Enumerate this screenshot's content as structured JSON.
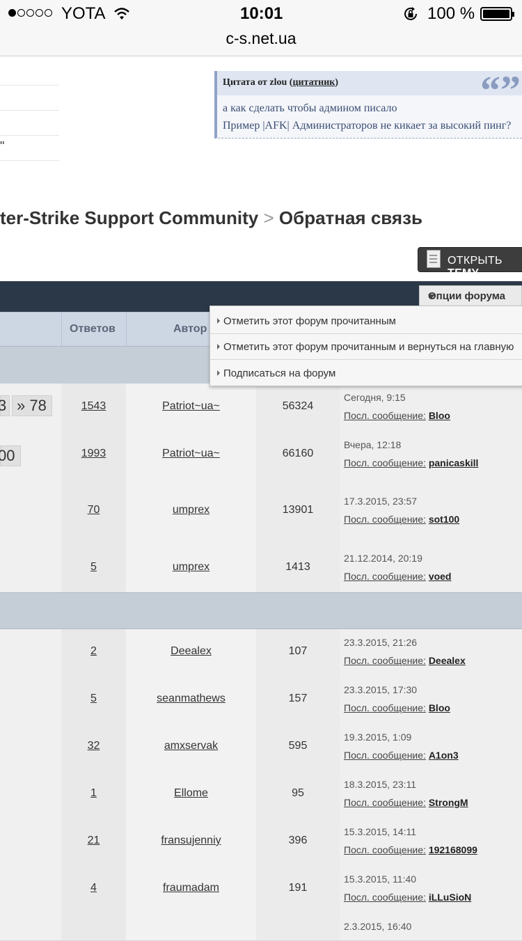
{
  "status": {
    "carrier": "YOTA",
    "time": "10:01",
    "battery": "100 %",
    "url": "c-s.net.ua"
  },
  "quote": {
    "author_prefix": "Цитата от zlou (",
    "link": "цитатник",
    "suffix": ")",
    "lines": [
      "а как сделать чтобы админом писало",
      "Пример |AFK| Администраторов не кикает за высокий пинг?"
    ]
  },
  "left_stub": "\"",
  "breadcrumb": {
    "parent": "ter-Strike Support Community",
    "sep": ">",
    "current": "Обратная связь"
  },
  "open_topic": {
    "label_a": "ОТКРЫТЬ ",
    "label_b": "ТЕМУ"
  },
  "forum_options": "Опции форума",
  "menu": [
    "Отметить этот форум прочитанным",
    "Отметить этот форум прочитанным и вернуться на главную",
    "Подписаться на форум"
  ],
  "columns": {
    "replies": "Ответов",
    "author": "Автор"
  },
  "pagers": {
    "row1_a": "3",
    "row1_b": "» 78",
    "row2": "00"
  },
  "last_prefix": "Посл. сообщение:",
  "rows": [
    {
      "replies": "1543",
      "author": "Patriot~ua~",
      "views": "56324",
      "date": "Сегодня, 9:15",
      "last_user": "Bloo"
    },
    {
      "replies": "1993",
      "author": "Patriot~ua~",
      "views": "66160",
      "date": "Вчера, 12:18",
      "last_user": "panicaskill"
    },
    {
      "replies": "70",
      "author": "umprex",
      "views": "13901",
      "date": "17.3.2015, 23:57",
      "last_user": "sot100"
    },
    {
      "replies": "5",
      "author": "umprex",
      "views": "1413",
      "date": "21.12.2014, 20:19",
      "last_user": "voed"
    },
    {
      "replies": "2",
      "author": "Deealex",
      "views": "107",
      "date": "23.3.2015, 21:26",
      "last_user": "Deealex"
    },
    {
      "replies": "5",
      "author": "seanmathews",
      "views": "157",
      "date": "23.3.2015, 17:30",
      "last_user": "Bloo"
    },
    {
      "replies": "32",
      "author": "amxservak",
      "views": "595",
      "date": "19.3.2015, 1:09",
      "last_user": "A1on3"
    },
    {
      "replies": "1",
      "author": "Ellome",
      "views": "95",
      "date": "18.3.2015, 23:11",
      "last_user": "StrongM"
    },
    {
      "replies": "21",
      "author": "fransujenniy",
      "views": "396",
      "date": "15.3.2015, 14:11",
      "last_user": "192168099"
    },
    {
      "replies": "4",
      "author": "fraumadam",
      "views": "191",
      "date": "15.3.2015, 11:40",
      "last_user": "iLLuSioN"
    },
    {
      "date": "2.3.2015, 16:40"
    }
  ]
}
